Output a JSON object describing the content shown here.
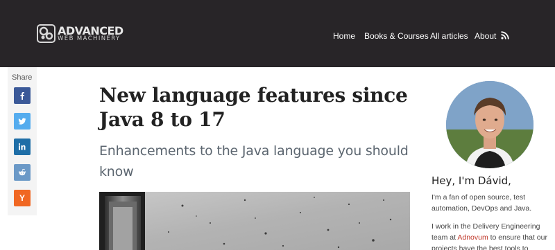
{
  "header": {
    "logo": {
      "line1": "ADVANCED",
      "line2": "WEB MACHINERY"
    },
    "nav": [
      {
        "label": "Home"
      },
      {
        "label": "Books & Courses"
      },
      {
        "label": "All articles"
      },
      {
        "label": "About"
      }
    ],
    "rss_icon": "rss-icon"
  },
  "share": {
    "label": "Share",
    "buttons": [
      {
        "network": "facebook",
        "icon": "facebook-icon",
        "color": "#3b5998"
      },
      {
        "network": "twitter",
        "icon": "twitter-icon",
        "color": "#55acee"
      },
      {
        "network": "linkedin",
        "icon": "linkedin-icon",
        "color": "#1e6ea7"
      },
      {
        "network": "reddit",
        "icon": "reddit-icon",
        "color": "#6b99c7"
      },
      {
        "network": "hackernews",
        "icon": "y-combinator-icon",
        "label": "Y",
        "color": "#f06722"
      }
    ]
  },
  "article": {
    "title": "New language features since Java 8 to 17",
    "subtitle": "Enhancements to the Java language you should know"
  },
  "sidebar": {
    "heading": "Hey, I'm Dávid,",
    "para1": "I'm a fan of open source, test automation, DevOps and Java.",
    "para2_before": "I work in the Delivery Engineering team at ",
    "para2_link": "Adnovum",
    "para2_after": " to ensure that our projects have the best tools to",
    "link_color": "#c0392b"
  }
}
